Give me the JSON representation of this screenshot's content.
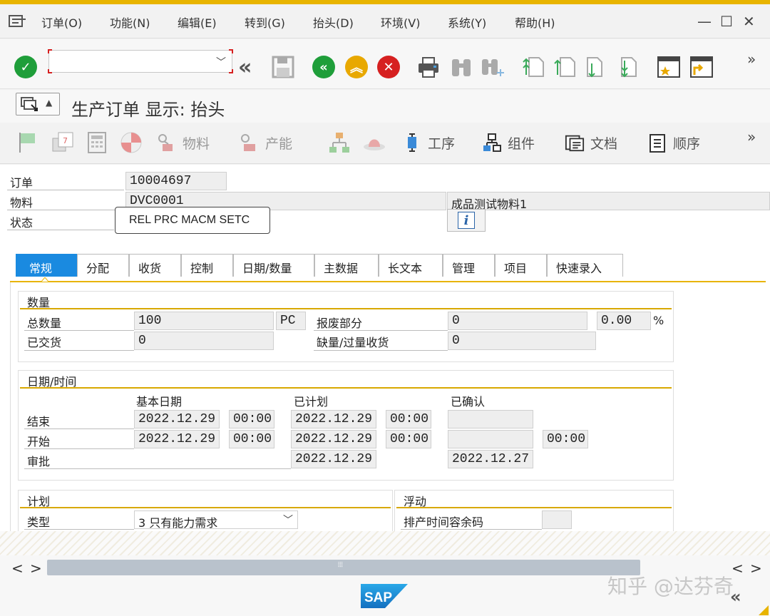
{
  "menu": [
    "订单(O)",
    "功能(N)",
    "编辑(E)",
    "转到(G)",
    "抬头(D)",
    "环境(V)",
    "系统(Y)",
    "帮助(H)"
  ],
  "window": {
    "minimize": "—",
    "maximize": "☐",
    "close": "✕"
  },
  "command_field": {
    "value": ""
  },
  "overflow": "»",
  "title": "生产订单 显示: 抬头",
  "toolbar2": {
    "material_label": "物料",
    "capacity_label": "产能",
    "operations_label": "工序",
    "components_label": "组件",
    "documents_label": "文档",
    "sequence_label": "顺序"
  },
  "header": {
    "order_label": "订单",
    "order_value": "10004697",
    "material_label": "物料",
    "material_value": "DVC0001",
    "material_desc": "成品测试物料1",
    "status_label": "状态",
    "status_value": "REL  PRC  MACM SETC",
    "info_icon_text": "i"
  },
  "tabs": [
    "常规",
    "分配",
    "收货",
    "控制",
    "日期/数量",
    "主数据",
    "长文本",
    "管理",
    "项目",
    "快速录入"
  ],
  "quantity": {
    "title": "数量",
    "total_label": "总数量",
    "total_value": "100",
    "unit": "PC",
    "scrap_label": "报废部分",
    "scrap_value": "0",
    "scrap_pct": "0.00",
    "pct_sign": "%",
    "delivered_label": "已交货",
    "delivered_value": "0",
    "short_excess_label": "缺量/过量收货",
    "short_excess_value": "0"
  },
  "dates": {
    "title": "日期/时间",
    "col_basic": "基本日期",
    "col_scheduled": "已计划",
    "col_confirmed": "已确认",
    "end_label": "结束",
    "end_basic_date": "2022.12.29",
    "end_basic_time": "00:00",
    "end_sched_date": "2022.12.29",
    "end_sched_time": "00:00",
    "end_conf_date": "",
    "start_label": "开始",
    "start_basic_date": "2022.12.29",
    "start_basic_time": "00:00",
    "start_sched_date": "2022.12.29",
    "start_sched_time": "00:00",
    "start_conf_date": "",
    "start_conf_time": "00:00",
    "release_label": "审批",
    "release_sched_date": "2022.12.29",
    "release_conf_date": "2022.12.27"
  },
  "scheduling": {
    "title": "计划",
    "type_label": "类型",
    "type_value": "3 只有能力需求"
  },
  "float": {
    "title": "浮动",
    "margin_label": "排产时间容余码",
    "margin_value": ""
  },
  "scroll": {
    "left": "<",
    "right": ">",
    "grip": "⦙⦙⦙"
  },
  "footer": {
    "logo_text": "SAP",
    "watermark": "知乎 @达芬奇"
  },
  "colors": {
    "accent": "#e8b400",
    "tab_active": "#1a8ae0",
    "ok_green": "#1f9e3a",
    "cancel_red": "#d62020"
  }
}
